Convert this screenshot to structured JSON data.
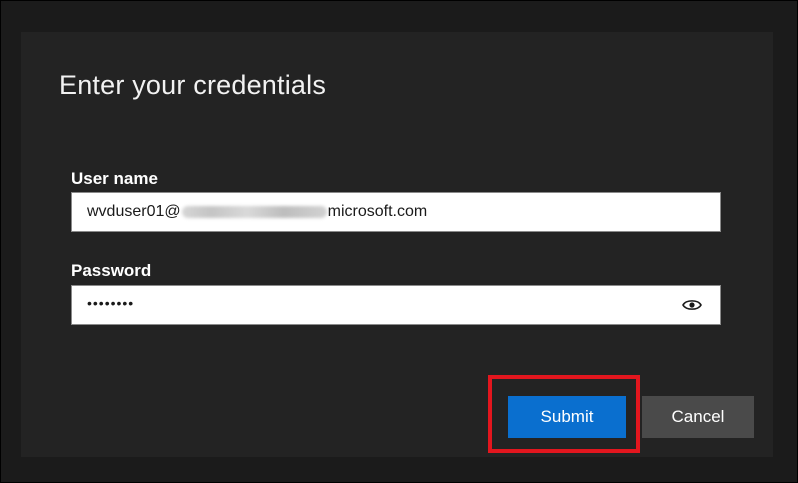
{
  "dialog": {
    "title": "Enter your credentials"
  },
  "username": {
    "label": "User name",
    "value_prefix": "wvduser01@",
    "value_suffix": "microsoft.com"
  },
  "password": {
    "label": "Password",
    "masked_value": "••••••••",
    "reveal_icon": "eye-icon"
  },
  "buttons": {
    "submit_label": "Submit",
    "cancel_label": "Cancel"
  },
  "colors": {
    "submit": "#0a6fcf",
    "cancel": "#4a4a4a",
    "highlight": "#e3161e",
    "dialog_bg": "#232323"
  }
}
